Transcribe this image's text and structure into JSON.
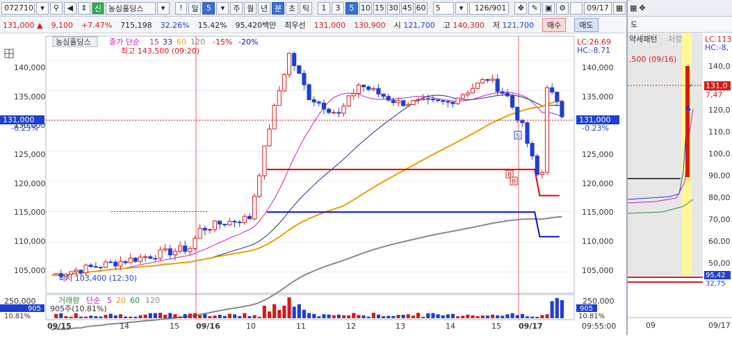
{
  "toolbar": {
    "code": "072710",
    "new_badge": "신",
    "stock_name": "농심홀딩스",
    "warn": "!",
    "period_label": "일",
    "period_value": "5",
    "periods": [
      "주",
      "월",
      "년",
      "분",
      "초",
      "틱"
    ],
    "numbers": [
      "1",
      "3",
      "5",
      "10",
      "15",
      "30",
      "45",
      "60"
    ],
    "count": "5",
    "range": "126/901",
    "date": "09/17"
  },
  "quote": {
    "price": "131,000 ▲",
    "change": "9,100",
    "change_rate": "+7.47%",
    "volume": "715,198",
    "turnover": "32.26%",
    "vol_ratio": "15.42%",
    "amount": "95,420백만",
    "best_ask_label": "최우선",
    "best_ask": "131,000",
    "best_bid": "130,900",
    "open_label": "시",
    "open": "121,700",
    "high_label": "고",
    "high": "140,300",
    "low_label": "저",
    "low": "121,700",
    "buy_label": "매수",
    "sell_label": "매도"
  },
  "legend": {
    "name": "농심홀딩스",
    "ma_label": "종가 단순",
    "ma_periods": [
      "15",
      "33",
      "60",
      "120"
    ],
    "bands": [
      "-15%",
      "-20%"
    ],
    "high_marker": "최고 143,500 (09:20)",
    "low_marker": "최저 103,400 (12:30)",
    "lc": "LC:26.69",
    "hc": "HC:-8.71"
  },
  "volume_legend": {
    "label": "거래량",
    "ma_label": "단순",
    "ma_periods": [
      "5",
      "20",
      "60",
      "120"
    ],
    "value": "905주(10.81%)"
  },
  "price_axis": {
    "ticks": [
      "140,000",
      "135,000",
      "130,000",
      "125,000",
      "120,000",
      "115,000",
      "110,000",
      "105,000"
    ],
    "current": "131,000",
    "current_pct": "-0.23%"
  },
  "volume_axis": {
    "ticks": [
      "250,000"
    ],
    "current": "905",
    "current_pct": "10.81%"
  },
  "time_axis": {
    "labels": [
      "09/15",
      "14",
      "15",
      "09/16",
      "10",
      "11",
      "12",
      "13",
      "14",
      "15",
      "09/17"
    ],
    "clock": "09:55:00"
  },
  "right_panel": {
    "tab": "도",
    "pattern_label": "약세패턴",
    "pattern_sub": "저항",
    "high_marker": ",500 (09/16)",
    "lc": "LC:113,",
    "hc": "HC:-8,",
    "price_tag": "131,0",
    "pct_tag": "7,47",
    "ticks": [
      "140,0",
      "130,0",
      "120,0",
      "110,0",
      "100,0",
      "90,00",
      "80,00",
      "70,00",
      "60,00",
      "50,00"
    ],
    "vol_tag": "95,42",
    "vol_pct": "32,75",
    "month": "09",
    "date": "09/17"
  },
  "signals": {
    "sell": "S",
    "buy": "B"
  },
  "colors": {
    "up": "#d7191c",
    "down": "#1f3fd0",
    "ma15": "#c020c0",
    "ma33": "#1a2f8a",
    "ma60": "#e8a000",
    "ma120": "#888888",
    "band15": "#e60000",
    "band20": "#0010d0"
  },
  "chart_data": {
    "type": "candlestick",
    "y_unit": "KRW",
    "ylim": [
      101500,
      144000
    ],
    "grid": true
  }
}
